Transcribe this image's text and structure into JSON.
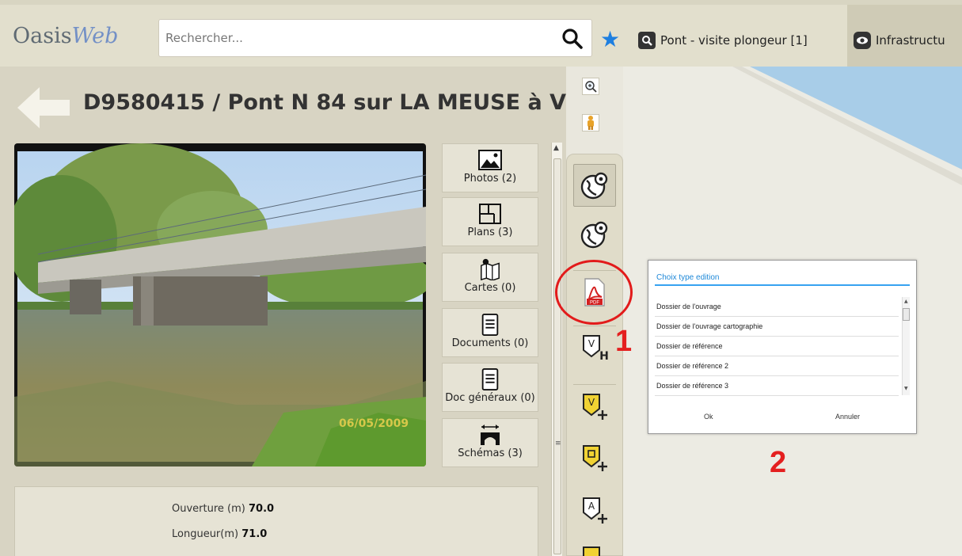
{
  "app": {
    "logo_main": "Oasis",
    "logo_accent": "Web"
  },
  "search": {
    "placeholder": "Rechercher..."
  },
  "header_tabs": [
    {
      "label": "Pont - visite plongeur [1]",
      "icon": "search-icon"
    },
    {
      "label": "Infrastructu",
      "icon": "eye-icon"
    }
  ],
  "page": {
    "title": "D9580415 / Pont N 84 sur LA MEUSE à V",
    "title_ellipsis": "...",
    "photo_date": "06/05/2009"
  },
  "side_buttons": [
    {
      "label": "Photos (2)",
      "icon": "image-icon"
    },
    {
      "label": "Plans (3)",
      "icon": "floorplan-icon"
    },
    {
      "label": "Cartes (0)",
      "icon": "map-pin-icon"
    },
    {
      "label": "Documents (0)",
      "icon": "document-icon"
    },
    {
      "label": "Doc généraux (0)",
      "icon": "document-icon"
    },
    {
      "label": "Schémas (3)",
      "icon": "bridge-schema-icon"
    }
  ],
  "info": [
    {
      "label": "Ouverture (m)",
      "value": "70.0"
    },
    {
      "label": "Longueur(m)",
      "value": "71.0"
    }
  ],
  "toolbar": {
    "items": [
      "globe-location-icon",
      "globe-location-icon",
      "pdf-icon",
      "visit-history-icon",
      "add-visit-icon",
      "add-d-icon",
      "add-a-icon"
    ]
  },
  "dialog": {
    "title": "Choix type edition",
    "options": [
      "Dossier de l'ouvrage",
      "Dossier de l'ouvrage cartographie",
      "Dossier de référence",
      "Dossier de référence 2",
      "Dossier de référence 3"
    ],
    "ok_label": "Ok",
    "cancel_label": "Annuler"
  },
  "annotations": {
    "marker_1": "1",
    "marker_2": "2"
  },
  "colors": {
    "accent": "#1e7fe0",
    "annotation": "#e21b1b",
    "dialog_title": "#1e88d8"
  }
}
